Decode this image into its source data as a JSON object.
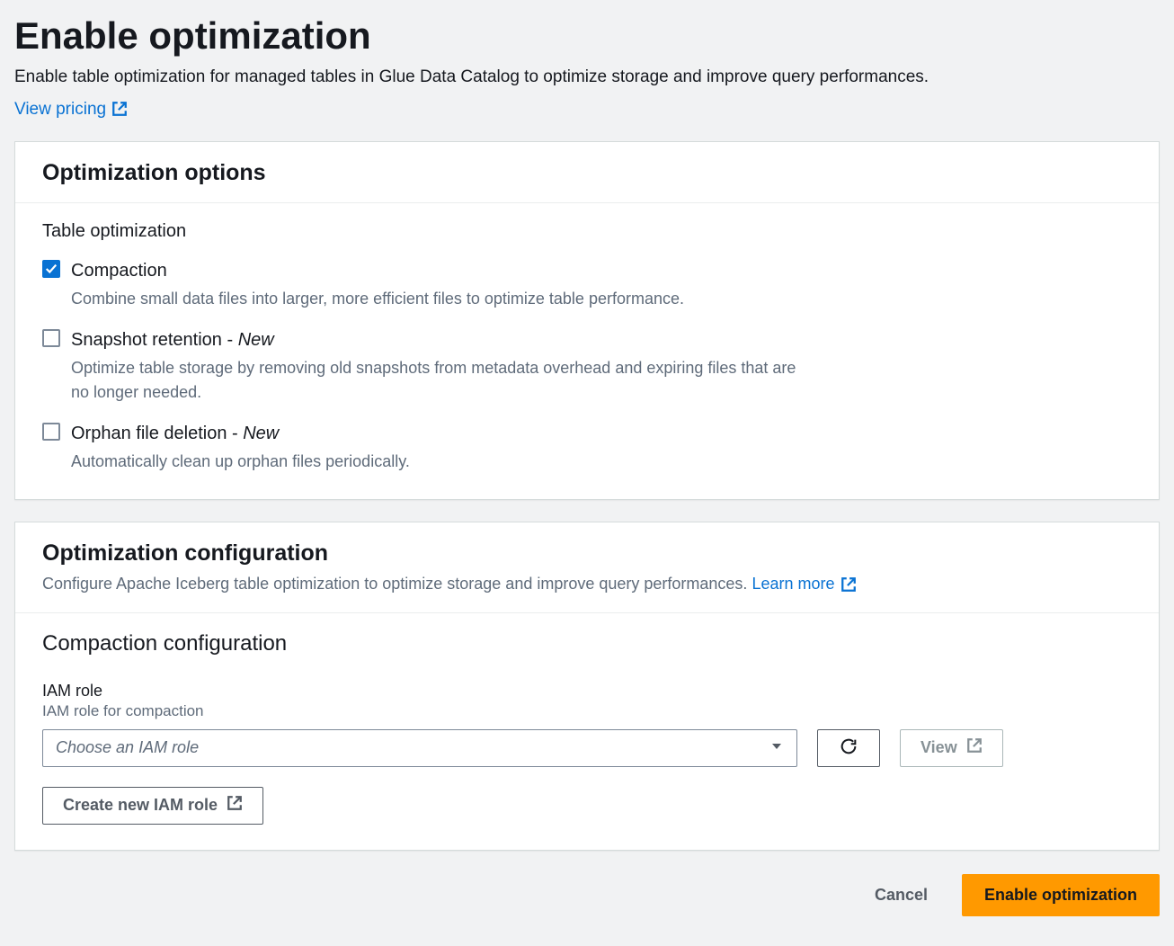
{
  "header": {
    "title": "Enable optimization",
    "description": "Enable table optimization for managed tables in Glue Data Catalog to optimize storage and improve query performances.",
    "view_pricing": "View pricing"
  },
  "options_card": {
    "title": "Optimization options",
    "section_label": "Table optimization",
    "items": [
      {
        "label": "Compaction",
        "new": "",
        "desc": "Combine small data files into larger, more efficient files to optimize table performance.",
        "checked": true
      },
      {
        "label": "Snapshot retention - ",
        "new": "New",
        "desc": "Optimize table storage by removing old snapshots from metadata overhead and expiring files that are no longer needed.",
        "checked": false
      },
      {
        "label": "Orphan file deletion - ",
        "new": "New",
        "desc": "Automatically clean up orphan files periodically.",
        "checked": false
      }
    ]
  },
  "config_card": {
    "title": "Optimization configuration",
    "desc": "Configure Apache Iceberg table optimization to optimize storage and improve query performances. ",
    "learn_more": "Learn more",
    "subsection": "Compaction configuration",
    "iam": {
      "label": "IAM role",
      "hint": "IAM role for compaction",
      "placeholder": "Choose an IAM role",
      "view_button": "View",
      "create_button": "Create new IAM role"
    }
  },
  "footer": {
    "cancel": "Cancel",
    "enable": "Enable optimization"
  }
}
